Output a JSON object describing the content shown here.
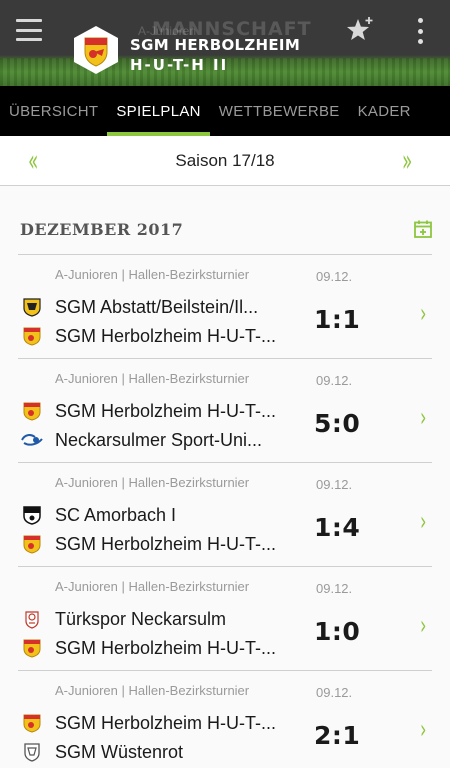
{
  "header": {
    "bg_word": "MANNSCHAFT",
    "bg_word_small": "A-Junioren",
    "team_line1": "SGM HERBOLZHEIM",
    "team_line2": "H-U-T-H II",
    "menu_icon": "hamburger-menu-icon",
    "favorite_icon": "star-plus-icon",
    "more_icon": "more-vertical-icon",
    "bg_color": "#3a3a3a",
    "grass_color": "#4e8a33"
  },
  "tabs": [
    {
      "label": "ÜBERSICHT",
      "active": false
    },
    {
      "label": "SPIELPLAN",
      "active": true
    },
    {
      "label": "WETTBEWERBE",
      "active": false
    },
    {
      "label": "KADER",
      "active": false
    }
  ],
  "season": {
    "label": "Saison 17/18",
    "prev_glyph": "«",
    "next_glyph": "»"
  },
  "month": {
    "label": "DEZEMBER 2017",
    "calendar_icon": "calendar-add-icon"
  },
  "matches": [
    {
      "competition": "A-Junioren | Hallen-Bezirksturnier",
      "date": "09.12.",
      "home": "SGM Abstatt/Beilstein/Il...",
      "away": "SGM Herbolzheim H-U-T-...",
      "score": "1:1",
      "home_logo": "abstatt-crest",
      "away_logo": "herbolzheim-crest"
    },
    {
      "competition": "A-Junioren | Hallen-Bezirksturnier",
      "date": "09.12.",
      "home": "SGM Herbolzheim H-U-T-...",
      "away": "Neckarsulmer Sport-Uni...",
      "score": "5:0",
      "home_logo": "herbolzheim-crest",
      "away_logo": "nsu-logo"
    },
    {
      "competition": "A-Junioren | Hallen-Bezirksturnier",
      "date": "09.12.",
      "home": "SC Amorbach I",
      "away": "SGM Herbolzheim H-U-T-...",
      "score": "1:4",
      "home_logo": "amorbach-crest",
      "away_logo": "herbolzheim-crest"
    },
    {
      "competition": "A-Junioren | Hallen-Bezirksturnier",
      "date": "09.12.",
      "home": "Türkspor Neckarsulm",
      "away": "SGM Herbolzheim H-U-T-...",
      "score": "1:0",
      "home_logo": "turkspor-crest",
      "away_logo": "herbolzheim-crest"
    },
    {
      "competition": "A-Junioren | Hallen-Bezirksturnier",
      "date": "09.12.",
      "home": "SGM Herbolzheim H-U-T-...",
      "away": "SGM Wüstenrot",
      "score": "2:1",
      "home_logo": "herbolzheim-crest",
      "away_logo": "wustenrot-crest"
    }
  ],
  "colors": {
    "accent": "#8dc63f",
    "tab_bar": "#000000",
    "text_muted": "#9a9a9a"
  }
}
